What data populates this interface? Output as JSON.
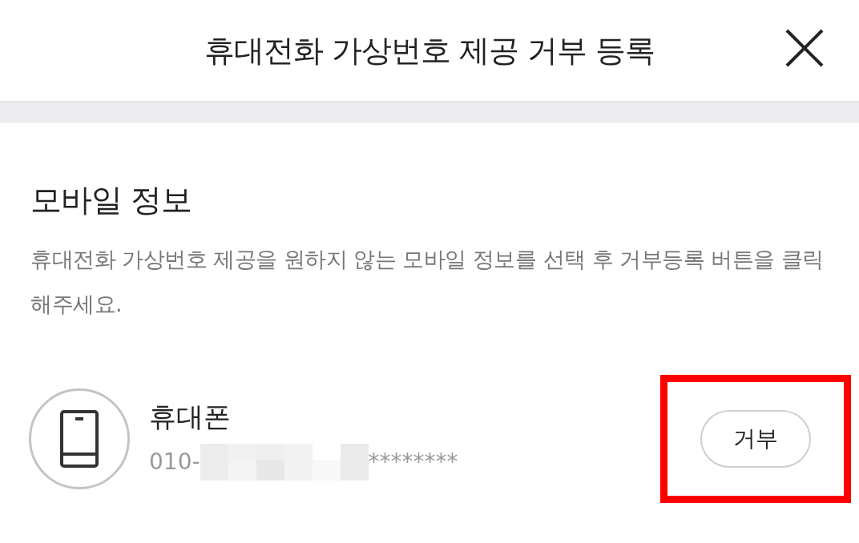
{
  "header": {
    "title": "휴대전화 가상번호 제공 거부 등록"
  },
  "section": {
    "heading": "모바일 정보",
    "description": "휴대전화 가상번호 제공을 원하지 않는 모바일 정보를 선택 후 거부등록 버튼을 클릭 해주세요."
  },
  "devices": [
    {
      "name": "휴대폰",
      "number_prefix": "010-",
      "number_suffix": "********",
      "button": "거부",
      "highlighted": true
    }
  ]
}
